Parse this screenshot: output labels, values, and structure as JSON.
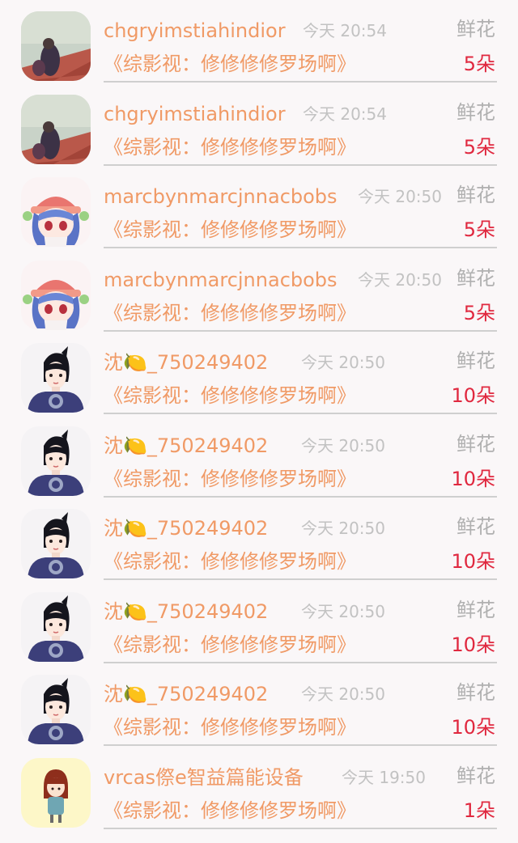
{
  "colors": {
    "accent": "#f09a66",
    "count": "#e0283f",
    "muted": "#c2c2c2",
    "divider": "#cfcfcf"
  },
  "rows": [
    {
      "avatar": "photo-avatar",
      "name": "chgryimstiahindior",
      "time": "今天 20:54",
      "gift": "鲜花",
      "title": "《综影视：修修修修罗场啊》",
      "count": "5朵"
    },
    {
      "avatar": "photo-avatar",
      "name": "chgryimstiahindior",
      "time": "今天 20:54",
      "gift": "鲜花",
      "title": "《综影视：修修修修罗场啊》",
      "count": "5朵"
    },
    {
      "avatar": "anime-girl-avatar",
      "name": "marcbynmarcjnnacbobs",
      "time": "今天 20:50",
      "gift": "鲜花",
      "title": "《综影视：修修修修罗场啊》",
      "count": "5朵"
    },
    {
      "avatar": "anime-girl-avatar",
      "name": "marcbynmarcjnnacbobs",
      "time": "今天 20:50",
      "gift": "鲜花",
      "title": "《综影视：修修修修罗场啊》",
      "count": "5朵"
    },
    {
      "avatar": "warrior-avatar",
      "name": "沈🍋_750249402",
      "time": "今天 20:50",
      "gift": "鲜花",
      "title": "《综影视：修修修修罗场啊》",
      "count": "10朵"
    },
    {
      "avatar": "warrior-avatar",
      "name": "沈🍋_750249402",
      "time": "今天 20:50",
      "gift": "鲜花",
      "title": "《综影视：修修修修罗场啊》",
      "count": "10朵"
    },
    {
      "avatar": "warrior-avatar",
      "name": "沈🍋_750249402",
      "time": "今天 20:50",
      "gift": "鲜花",
      "title": "《综影视：修修修修罗场啊》",
      "count": "10朵"
    },
    {
      "avatar": "warrior-avatar",
      "name": "沈🍋_750249402",
      "time": "今天 20:50",
      "gift": "鲜花",
      "title": "《综影视：修修修修罗场啊》",
      "count": "10朵"
    },
    {
      "avatar": "warrior-avatar",
      "name": "沈🍋_750249402",
      "time": "今天 20:50",
      "gift": "鲜花",
      "title": "《综影视：修修修修罗场啊》",
      "count": "10朵"
    },
    {
      "avatar": "cartoon-girl-avatar",
      "name": "vrcas傺e智益篇能设备",
      "time": "今天 19:50",
      "gift": "鲜花",
      "title": "《综影视：修修修修罗场啊》",
      "count": "1朵"
    }
  ]
}
